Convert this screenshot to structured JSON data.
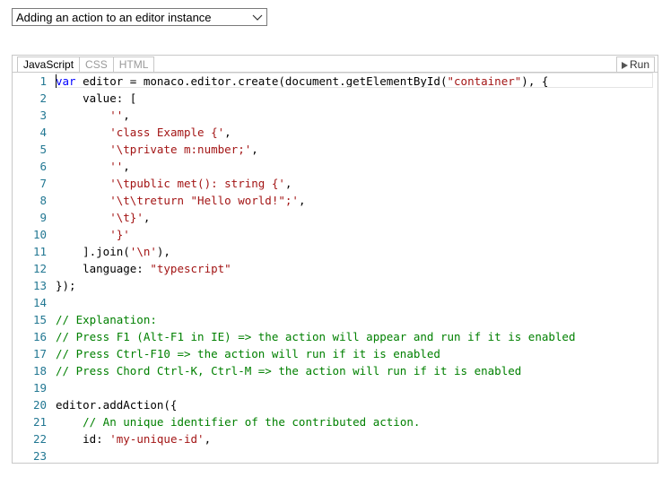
{
  "sample_selector": {
    "selected": "Adding an action to an editor instance"
  },
  "tabs": [
    {
      "label": "JavaScript",
      "active": true
    },
    {
      "label": "CSS",
      "active": false
    },
    {
      "label": "HTML",
      "active": false
    }
  ],
  "run_button": {
    "label": "Run"
  },
  "colors": {
    "keyword": "#0000ff",
    "string": "#a31515",
    "comment": "#008000",
    "line_number": "#237893"
  },
  "code_lines": [
    {
      "n": "1",
      "tokens": [
        {
          "t": "kw",
          "v": "var"
        },
        {
          "t": "",
          "v": " editor = monaco.editor.create(document.getElementById("
        },
        {
          "t": "str",
          "v": "\"container\""
        },
        {
          "t": "",
          "v": "), {"
        }
      ]
    },
    {
      "n": "2",
      "tokens": [
        {
          "t": "",
          "v": "    value: ["
        }
      ]
    },
    {
      "n": "3",
      "tokens": [
        {
          "t": "",
          "v": "        "
        },
        {
          "t": "str",
          "v": "''"
        },
        {
          "t": "",
          "v": ","
        }
      ]
    },
    {
      "n": "4",
      "tokens": [
        {
          "t": "",
          "v": "        "
        },
        {
          "t": "str",
          "v": "'class Example {'"
        },
        {
          "t": "",
          "v": ","
        }
      ]
    },
    {
      "n": "5",
      "tokens": [
        {
          "t": "",
          "v": "        "
        },
        {
          "t": "str",
          "v": "'\\tprivate m:number;'"
        },
        {
          "t": "",
          "v": ","
        }
      ]
    },
    {
      "n": "6",
      "tokens": [
        {
          "t": "",
          "v": "        "
        },
        {
          "t": "str",
          "v": "''"
        },
        {
          "t": "",
          "v": ","
        }
      ]
    },
    {
      "n": "7",
      "tokens": [
        {
          "t": "",
          "v": "        "
        },
        {
          "t": "str",
          "v": "'\\tpublic met(): string {'"
        },
        {
          "t": "",
          "v": ","
        }
      ]
    },
    {
      "n": "8",
      "tokens": [
        {
          "t": "",
          "v": "        "
        },
        {
          "t": "str",
          "v": "'\\t\\treturn \"Hello world!\";'"
        },
        {
          "t": "",
          "v": ","
        }
      ]
    },
    {
      "n": "9",
      "tokens": [
        {
          "t": "",
          "v": "        "
        },
        {
          "t": "str",
          "v": "'\\t}'"
        },
        {
          "t": "",
          "v": ","
        }
      ]
    },
    {
      "n": "10",
      "tokens": [
        {
          "t": "",
          "v": "        "
        },
        {
          "t": "str",
          "v": "'}'"
        }
      ]
    },
    {
      "n": "11",
      "tokens": [
        {
          "t": "",
          "v": "    ].join("
        },
        {
          "t": "str",
          "v": "'\\n'"
        },
        {
          "t": "",
          "v": "),"
        }
      ]
    },
    {
      "n": "12",
      "tokens": [
        {
          "t": "",
          "v": "    language: "
        },
        {
          "t": "str",
          "v": "\"typescript\""
        }
      ]
    },
    {
      "n": "13",
      "tokens": [
        {
          "t": "",
          "v": "});"
        }
      ]
    },
    {
      "n": "14",
      "tokens": []
    },
    {
      "n": "15",
      "tokens": [
        {
          "t": "cmt",
          "v": "// Explanation:"
        }
      ]
    },
    {
      "n": "16",
      "tokens": [
        {
          "t": "cmt",
          "v": "// Press F1 (Alt-F1 in IE) => the action will appear and run if it is enabled"
        }
      ]
    },
    {
      "n": "17",
      "tokens": [
        {
          "t": "cmt",
          "v": "// Press Ctrl-F10 => the action will run if it is enabled"
        }
      ]
    },
    {
      "n": "18",
      "tokens": [
        {
          "t": "cmt",
          "v": "// Press Chord Ctrl-K, Ctrl-M => the action will run if it is enabled"
        }
      ]
    },
    {
      "n": "19",
      "tokens": []
    },
    {
      "n": "20",
      "tokens": [
        {
          "t": "",
          "v": "editor.addAction({"
        }
      ]
    },
    {
      "n": "21",
      "tokens": [
        {
          "t": "",
          "v": "    "
        },
        {
          "t": "cmt",
          "v": "// An unique identifier of the contributed action."
        }
      ]
    },
    {
      "n": "22",
      "tokens": [
        {
          "t": "",
          "v": "    id: "
        },
        {
          "t": "str",
          "v": "'my-unique-id'"
        },
        {
          "t": "",
          "v": ","
        }
      ]
    },
    {
      "n": "23",
      "tokens": []
    }
  ]
}
